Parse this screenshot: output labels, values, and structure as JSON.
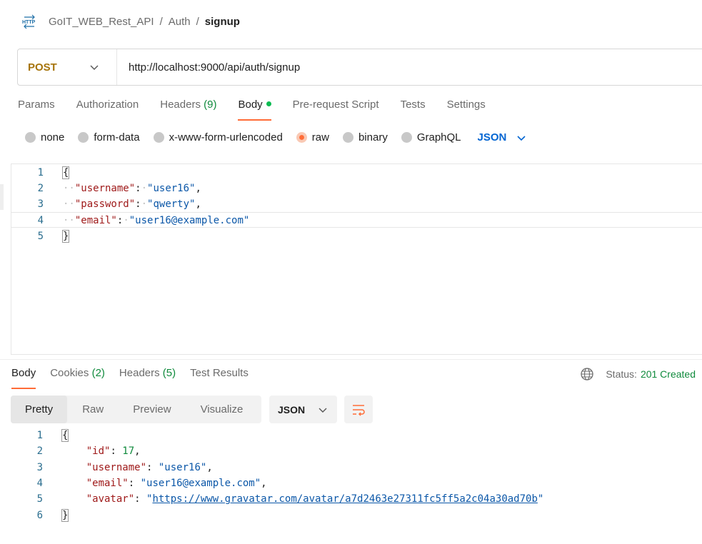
{
  "breadcrumb": {
    "icon": "http-request-icon",
    "collection": "GoIT_WEB_Rest_API",
    "folder": "Auth",
    "request": "signup",
    "separator": "/"
  },
  "request": {
    "method": "POST",
    "url": "http://localhost:9000/api/auth/signup"
  },
  "request_tabs": [
    {
      "label": "Params",
      "count": "",
      "active": false
    },
    {
      "label": "Authorization",
      "count": "",
      "active": false
    },
    {
      "label": "Headers",
      "count": "(9)",
      "active": false
    },
    {
      "label": "Body",
      "count": "",
      "active": true
    },
    {
      "label": "Pre-request Script",
      "count": "",
      "active": false
    },
    {
      "label": "Tests",
      "count": "",
      "active": false
    },
    {
      "label": "Settings",
      "count": "",
      "active": false
    }
  ],
  "body_types": [
    "none",
    "form-data",
    "x-www-form-urlencoded",
    "raw",
    "binary",
    "GraphQL"
  ],
  "body_type_selected": "raw",
  "body_format": "JSON",
  "request_body": {
    "line_numbers": [
      "1",
      "2",
      "3",
      "4",
      "5"
    ],
    "open_brace": "{",
    "close_brace": "}",
    "fields": [
      {
        "key": "\"username\"",
        "value": "\"user16\"",
        "sep": ","
      },
      {
        "key": "\"password\"",
        "value": "\"qwerty\"",
        "sep": ","
      },
      {
        "key": "\"email\"",
        "value": "\"user16@example.com\"",
        "sep": ""
      }
    ]
  },
  "response_tabs": [
    {
      "label": "Body",
      "count": "",
      "active": true
    },
    {
      "label": "Cookies",
      "count": "(2)",
      "active": false
    },
    {
      "label": "Headers",
      "count": "(5)",
      "active": false
    },
    {
      "label": "Test Results",
      "count": "",
      "active": false
    }
  ],
  "status": {
    "label": "Status:",
    "value": "201 Created"
  },
  "view_modes": [
    "Pretty",
    "Raw",
    "Preview",
    "Visualize"
  ],
  "view_mode_selected": "Pretty",
  "response_format": "JSON",
  "response_body": {
    "line_numbers": [
      "1",
      "2",
      "3",
      "4",
      "5",
      "6"
    ],
    "open_brace": "{",
    "close_brace": "}",
    "fields": [
      {
        "key": "\"id\"",
        "value": "17",
        "type": "number",
        "sep": ","
      },
      {
        "key": "\"username\"",
        "value": "\"user16\"",
        "type": "string",
        "sep": ","
      },
      {
        "key": "\"email\"",
        "value": "\"user16@example.com\"",
        "type": "string",
        "sep": ","
      },
      {
        "key": "\"avatar\"",
        "value": "https://www.gravatar.com/avatar/a7d2463e27311fc5ff5a2c04a30ad70b",
        "type": "link",
        "sep": ""
      }
    ]
  },
  "colors": {
    "accent": "#ff6c37",
    "method": "#a6740b",
    "status_ok": "#0f8a3c",
    "json_key": "#9e1818",
    "json_string": "#0b57a8"
  }
}
